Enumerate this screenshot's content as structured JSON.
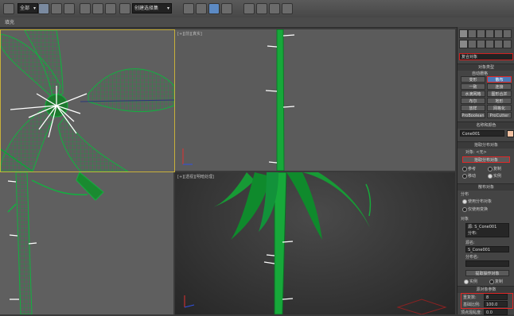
{
  "toolbar": {
    "selection_filter": "全部",
    "named_selection": "创建选择集",
    "icons": [
      "undo-icon",
      "redo-icon",
      "link-icon",
      "unlink-icon",
      "bind-icon",
      "select-icon",
      "select-by-name-icon",
      "rect-select-icon",
      "window-crossing-icon",
      "move-icon",
      "rotate-icon",
      "scale-icon",
      "reference-coord-icon",
      "pivot-icon",
      "select-manipulate-icon",
      "keyboard-shortcut-icon",
      "snap-icon",
      "angle-snap-icon",
      "percent-snap-icon",
      "spinner-snap-icon",
      "mirror-icon",
      "align-icon",
      "layer-icon",
      "curve-editor-icon",
      "schematic-icon",
      "material-editor-icon",
      "render-setup-icon",
      "render-frame-icon",
      "render-icon"
    ]
  },
  "ribbon": {
    "label": "填充"
  },
  "viewports": {
    "top_left": {
      "label": ""
    },
    "top_right": {
      "label": "[+][前][真实]"
    },
    "bottom_right": {
      "label": "[+][透视][明暗处理]"
    }
  },
  "panel": {
    "object_type_dropdown": "复合对象",
    "object_type_section": "对象类型",
    "autogrid_label": "自动栅格",
    "buttons": [
      "变形",
      "散布",
      "一致",
      "连接",
      "水滴网格",
      "图形合并",
      "布尔",
      "地形",
      "放样",
      "网格化",
      "ProBoolean",
      "ProCutter"
    ],
    "name_color_section": "名称和颜色",
    "object_name": "Cone001",
    "pick_section": "拾取分布对象",
    "object_label": "对象: <无>",
    "pick_button": "拾取分布对象",
    "pick_options": [
      "参考",
      "复制",
      "移动",
      "实例"
    ],
    "scatter_objects_section": "散布对象",
    "distribution_title": "分布",
    "distribution_options": [
      "使用分布对象",
      "仅使用变换"
    ],
    "objects_title": "对象",
    "object_list": [
      "源: S_Cone001",
      "分布:"
    ],
    "source_name_label": "源名:",
    "source_name_value": "S_Cone001",
    "dist_name_label": "分布名:",
    "extract_button": "提取操作对象",
    "extract_options": [
      "实例",
      "复制"
    ],
    "source_params_section": "源对象参数",
    "duplicates_label": "重复数:",
    "duplicates_value": "8",
    "base_scale_label": "基础比例:",
    "base_scale_value": "100.0",
    "vertex_chaos_label": "顶点混乱度:",
    "vertex_chaos_value": "0.0"
  }
}
